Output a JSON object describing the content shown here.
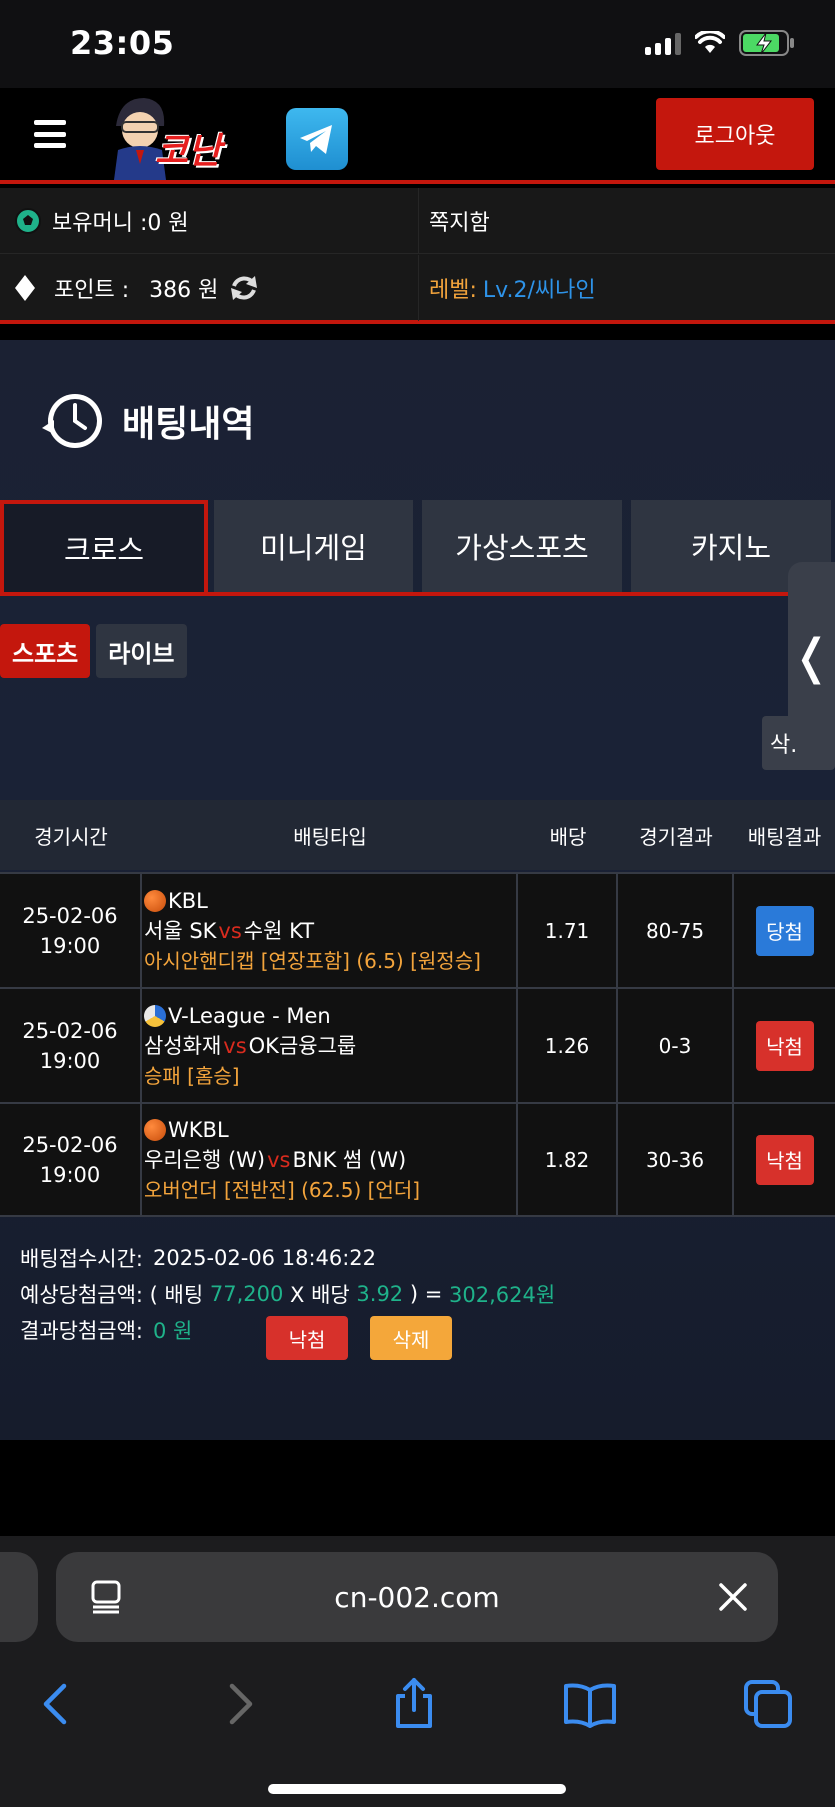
{
  "status_bar": {
    "time": "23:05"
  },
  "header": {
    "logo_text": "코난",
    "logout_label": "로그아웃"
  },
  "info": {
    "money_label": "보유머니 :0 원",
    "message_label": "쪽지함",
    "points_label": "포인트 :",
    "points_value": "386 원",
    "level_label": "레벨:",
    "level_value": "Lv.2/씨나인"
  },
  "page": {
    "title": "배팅내역",
    "tabs": [
      {
        "label": "크로스",
        "active": true
      },
      {
        "label": "미니게임",
        "active": false
      },
      {
        "label": "가상스포츠",
        "active": false
      },
      {
        "label": "카지노",
        "active": false
      }
    ],
    "subtabs": [
      {
        "label": "스포츠",
        "active": true
      },
      {
        "label": "라이브",
        "active": false
      }
    ],
    "side_handle": "❬",
    "delete_selected_label": "삭."
  },
  "table": {
    "headers": [
      "경기시간",
      "배팅타입",
      "배당",
      "경기결과",
      "배팅결과"
    ],
    "rows": [
      {
        "date": "25-02-06",
        "time": "19:00",
        "sport_icon": "basketball-icon",
        "league": "KBL",
        "home": "서울 SK",
        "vs": "vs",
        "away": "수원 KT",
        "bet": "아시안핸디캡 [연장포함] (6.5) [원정승]",
        "odds": "1.71",
        "score": "80-75",
        "result": "당첨",
        "result_type": "win"
      },
      {
        "date": "25-02-06",
        "time": "19:00",
        "sport_icon": "volleyball-icon",
        "league": "V-League - Men",
        "home": "삼성화재",
        "vs": "vs",
        "away": "OK금융그룹",
        "bet": "승패 [홈승]",
        "odds": "1.26",
        "score": "0-3",
        "result": "낙첨",
        "result_type": "lose"
      },
      {
        "date": "25-02-06",
        "time": "19:00",
        "sport_icon": "basketball-icon",
        "league": "WKBL",
        "home": "우리은행 (W)",
        "vs": "vs",
        "away": "BNK 썸 (W)",
        "bet": "오버언더 [전반전] (62.5) [언더]",
        "odds": "1.82",
        "score": "30-36",
        "result": "낙첨",
        "result_type": "lose"
      }
    ]
  },
  "summary": {
    "time_label": "배팅접수시간:",
    "time_value": "2025-02-06 18:46:22",
    "expected_prefix": "예상당첨금액: ( 배팅 ",
    "stake": "77,200",
    "x_odds": " X 배당 ",
    "total_odds": "3.92",
    "close_eq": " ) = ",
    "expected_amount": "302,624원",
    "result_label": "결과당첨금액:",
    "result_amount": "0 원",
    "lose_button": "낙첨",
    "delete_button": "삭제"
  },
  "browser": {
    "url": "cn-002.com"
  },
  "colors": {
    "brand_red": "#c4170d",
    "accent_orange": "#f3a43c",
    "level_blue": "#2e93e8",
    "teal": "#1fb28a",
    "win_blue": "#2a7ad9",
    "lose_red": "#d7312b"
  }
}
